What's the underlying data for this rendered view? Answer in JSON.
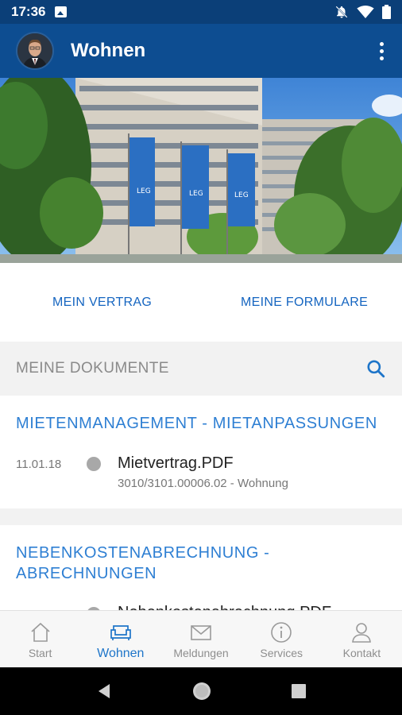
{
  "status_bar": {
    "time": "17:36"
  },
  "app_bar": {
    "title": "Wohnen"
  },
  "links": {
    "contract": "MEIN VERTRAG",
    "forms": "MEINE FORMULARE"
  },
  "documents": {
    "header": "MEINE DOKUMENTE",
    "sections": [
      {
        "category": "MIETENMANAGEMENT - MIETANPASSUNGEN",
        "items": [
          {
            "date": "11.01.18",
            "filename": "Mietvertrag.PDF",
            "subtitle": "3010/3101.00006.02 - Wohnung"
          }
        ]
      },
      {
        "category": "NEBENKOSTENABRECHNUNG - ABRECHNUNGEN",
        "items": [
          {
            "date": "",
            "filename": "Nebenkostenabrechnung.PDF",
            "subtitle": ""
          }
        ]
      }
    ]
  },
  "bottom_nav": [
    {
      "label": "Start",
      "icon": "home-icon",
      "active": false
    },
    {
      "label": "Wohnen",
      "icon": "sofa-icon",
      "active": true
    },
    {
      "label": "Meldungen",
      "icon": "mail-icon",
      "active": false
    },
    {
      "label": "Services",
      "icon": "info-icon",
      "active": false
    },
    {
      "label": "Kontakt",
      "icon": "person-icon",
      "active": false
    }
  ],
  "colors": {
    "primary": "#0d4d91",
    "status_bar": "#0b3f78",
    "accent": "#1e75c9"
  }
}
